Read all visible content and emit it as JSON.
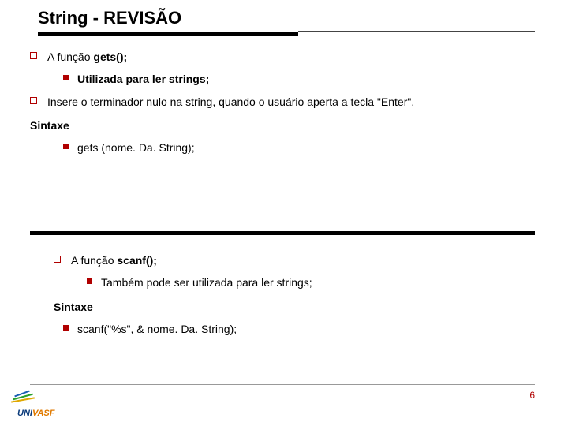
{
  "title": "String - REVISÃO",
  "top": {
    "func_prefix": "A função ",
    "func_name": "gets();",
    "usage": "Utilizada para ler strings;",
    "insert_desc": "Insere o terminador nulo na string, quando o usuário aperta a tecla \"Enter\".",
    "syntax_label": "Sintaxe",
    "syntax_code": "gets (nome. Da. String);"
  },
  "bottom": {
    "func_prefix": "A função ",
    "func_name": "scanf();",
    "usage": "Também pode ser utilizada para ler strings;",
    "syntax_label": "Sintaxe",
    "syntax_code": "scanf(\"%s\", & nome. Da. String);"
  },
  "page_number": "6",
  "logo_text_a": "UNI",
  "logo_text_b": "VASF"
}
